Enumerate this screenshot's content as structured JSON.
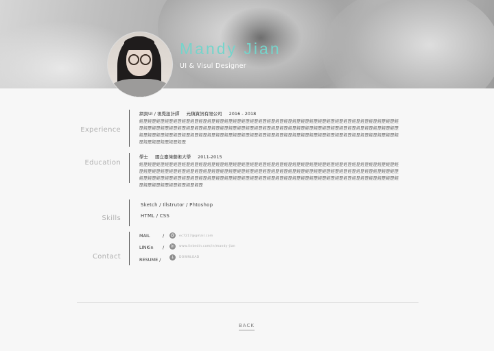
{
  "header": {
    "name": "Mandy Jian",
    "role": "UI & Visul Designer"
  },
  "sections": {
    "experience": "Experience",
    "education": "Education",
    "skills": "Skills",
    "contact": "Contact"
  },
  "experience": {
    "title": "網頁UI / 視覺設計師",
    "company": "元稹資訊有限公司",
    "period": "2016 - 2018",
    "desc": "經歷經歷經歷經歷經歷經歷經歷經歷經歷經歷經歷經歷經歷經歷經歷經歷經歷經歷經歷經歷經歷經歷經歷經歷經歷經歷經歷經歷經歷經歷經歷經歷經歷經歷經歷經歷經歷經歷經歷經歷經歷經歷經歷經歷經歷經歷經歷經歷經歷經歷經歷經歷經歷經歷經歷經歷經歷經歷經歷經歷經歷經歷經歷經歷經歷經歷經歷經歷經歷經歷經歷經歷經歷經歷經歷經歷經歷經歷經歷經歷經歷經歷經歷經歷經歷經歷經歷經歷經歷經歷經歷經歷經歷經歷經歷經歷經歷"
  },
  "education": {
    "degree": "學士",
    "school": "國立臺灣藝術大學",
    "period": "2011-2015",
    "desc": "經歷經歷經歷經歷經歷經歷經歷經歷經歷經歷經歷經歷經歷經歷經歷經歷經歷經歷經歷經歷經歷經歷經歷經歷經歷經歷經歷經歷經歷經歷經歷經歷經歷經歷經歷經歷經歷經歷經歷經歷經歷經歷經歷經歷經歷經歷經歷經歷經歷經歷經歷經歷經歷經歷經歷經歷經歷經歷經歷經歷經歷經歷經歷經歷經歷經歷經歷經歷經歷經歷經歷經歷經歷經歷經歷經歷經歷經歷經歷經歷經歷經歷經歷經歷經歷經歷經歷經歷經歷經歷經歷經歷經歷經歷經歷經歷經歷經歷經歷"
  },
  "skills": [
    "Sketch  / Illstrutor / Phtoshop",
    "HTML / CSS"
  ],
  "contact": {
    "mail_label": "MAIL",
    "mail_value": "ec7217@gmail.com",
    "linkin_label": "LINKin",
    "linkin_value": "www.linkedin.com/in/mandy-jian",
    "resume_label": "RESUME /",
    "resume_value": "DOWNLOAD",
    "slash": "/"
  },
  "footer": {
    "back": "BACK"
  },
  "icons": {
    "mail": "email-icon",
    "linkin": "link-icon",
    "resume": "download-icon"
  },
  "colors": {
    "accent": "#76d4cb"
  }
}
